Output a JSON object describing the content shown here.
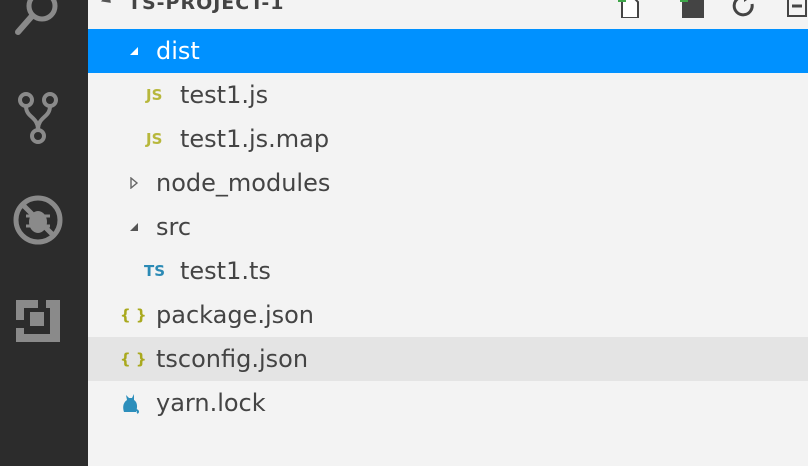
{
  "explorer": {
    "section_title": "TS-PROJECT-1",
    "items": [
      {
        "label": "dist",
        "icon": "folder-open-chevron",
        "state": "selected"
      },
      {
        "label": "test1.js",
        "icon_text": "JS",
        "icon": "js-file-icon"
      },
      {
        "label": "test1.js.map",
        "icon_text": "JS",
        "icon": "js-file-icon"
      },
      {
        "label": "node_modules",
        "icon": "folder-closed-chevron"
      },
      {
        "label": "src",
        "icon": "folder-open-chevron"
      },
      {
        "label": "test1.ts",
        "icon_text": "TS",
        "icon": "ts-file-icon"
      },
      {
        "label": "package.json",
        "icon_text": "{ }",
        "icon": "json-file-icon"
      },
      {
        "label": "tsconfig.json",
        "icon_text": "{ }",
        "icon": "json-file-icon",
        "state": "hovered"
      },
      {
        "label": "yarn.lock",
        "icon": "yarn-cat-icon"
      }
    ]
  },
  "colors": {
    "activity_bar": "#2c2c2c",
    "sidebar": "#f3f3f3",
    "selection": "#0091ff",
    "hover": "#e4e4e4",
    "js_icon": "#b7b73b",
    "ts_icon": "#2b8ab5",
    "json_icon": "#a9a91e",
    "yarn_icon": "#2c8ebb"
  }
}
